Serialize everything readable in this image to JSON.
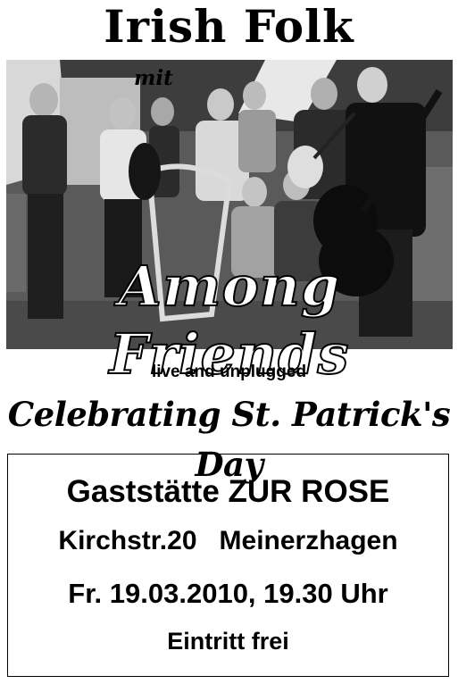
{
  "poster": {
    "title": "Irish Folk",
    "intro": "mit",
    "band_name": "Among Friends",
    "subtitle": "live and unplugged",
    "headline": "Celebrating St. Patrick's Day"
  },
  "venue": {
    "name": "Gaststätte ZUR ROSE",
    "street": "Kirchstr.20",
    "city": "Meinerzhagen",
    "date_time": "Fr. 19.03.2010, 19.30 Uhr",
    "entry": "Eintritt frei"
  }
}
